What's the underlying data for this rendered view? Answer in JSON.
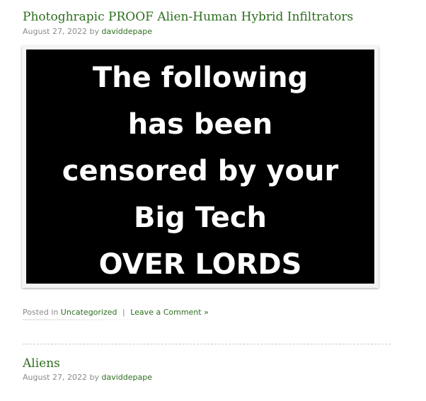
{
  "posts": [
    {
      "title": "Photoghrapic PROOF Alien-Human Hybrid Infiltrators",
      "date": "August 27, 2022",
      "by": "by",
      "author": "daviddepape",
      "image_lines": [
        "The following",
        "has been",
        "censored by your",
        "Big Tech",
        "OVER LORDS"
      ],
      "footer": {
        "posted_in": "Posted in",
        "category": "Uncategorized",
        "separator": "|",
        "comment": "Leave a Comment »"
      }
    },
    {
      "title": "Aliens",
      "date": "August 27, 2022",
      "by": "by",
      "author": "daviddepape"
    }
  ],
  "colors": {
    "link": "#2d6e1e",
    "meta": "#8a8a8a",
    "image_bg": "#000000",
    "image_text": "#ffffff"
  }
}
